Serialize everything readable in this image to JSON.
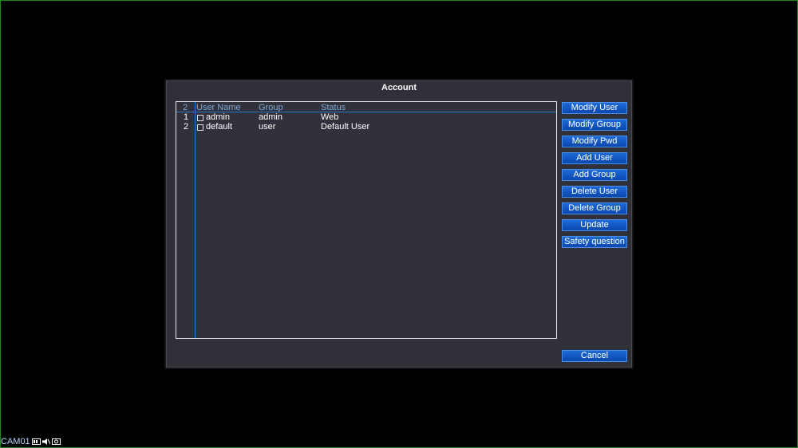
{
  "dialog": {
    "title": "Account"
  },
  "table": {
    "count": "2",
    "headers": {
      "username": "User Name",
      "group": "Group",
      "status": "Status"
    },
    "rows": [
      {
        "index": "1",
        "username": "admin",
        "group": "admin",
        "status": "Web"
      },
      {
        "index": "2",
        "username": "default",
        "group": "user",
        "status": "Default User"
      }
    ]
  },
  "buttons": {
    "modify_user": "Modify User",
    "modify_group": "Modify Group",
    "modify_pwd": "Modify Pwd",
    "add_user": "Add User",
    "add_group": "Add Group",
    "delete_user": "Delete User",
    "delete_group": "Delete Group",
    "update": "Update",
    "safety_question": "Safety question",
    "cancel": "Cancel"
  },
  "statusbar": {
    "camera": "CAM01",
    "icons": [
      "video-icon",
      "speaker-icon",
      "camera-icon"
    ]
  },
  "colors": {
    "accent": "#2b78c8",
    "button": "#0a48ae",
    "background": "#000000",
    "dialog": "#2f3038"
  }
}
